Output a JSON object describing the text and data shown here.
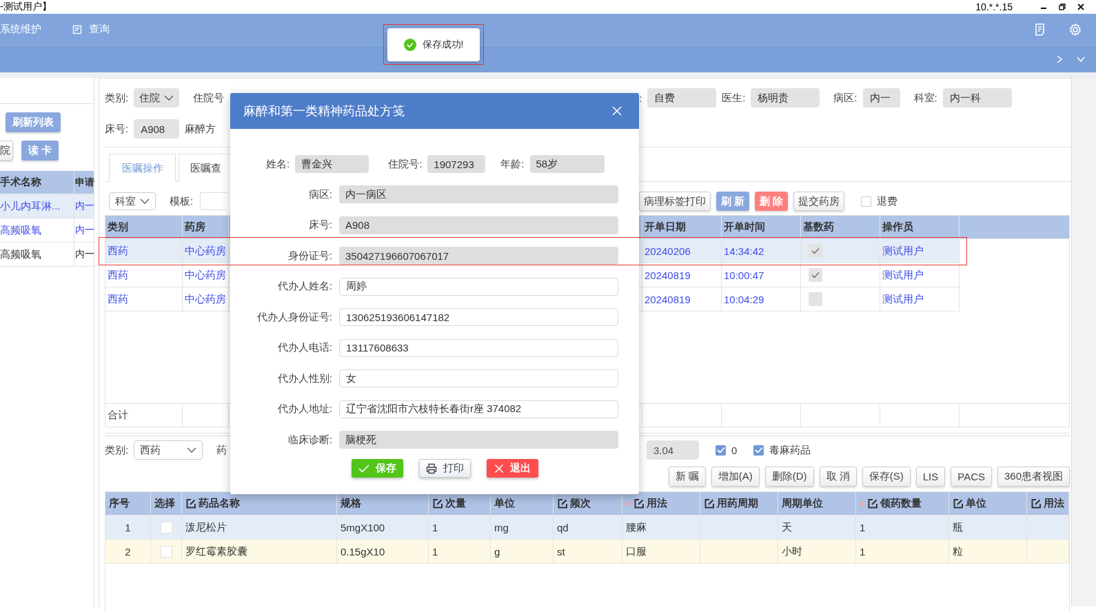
{
  "title_bar": {
    "title": "-测试用户】",
    "address": "10.*.*.15"
  },
  "nav": {
    "items": [
      {
        "label": "系统维护",
        "kind": "text"
      },
      {
        "label": "查询",
        "kind": "icon"
      }
    ]
  },
  "toast": {
    "message": "保存成功!",
    "highlighted": true
  },
  "left_panel": {
    "buttons": [
      {
        "label": "刷新列表",
        "kind": "primary"
      },
      {
        "label": "院",
        "kind": "plain"
      },
      {
        "label": "读 卡",
        "kind": "primary"
      }
    ],
    "columns": [
      "手术名称",
      "申请"
    ],
    "rows": [
      {
        "cells": [
          "小儿内耳淋...",
          "内一"
        ],
        "selected": true,
        "color": "#3d4bea"
      },
      {
        "cells": [
          "高频吸氧",
          "内一"
        ],
        "selected": false,
        "color": "#3d4bea"
      },
      {
        "cells": [
          "高频吸氧",
          "内一"
        ],
        "selected": false,
        "color": "#333333"
      }
    ]
  },
  "filters": {
    "row1_left": [
      {
        "label": "类别:",
        "value": "住院",
        "kind": "select"
      },
      {
        "label": "住院号",
        "kind": "label"
      }
    ],
    "row1_right": [
      {
        "label": ":",
        "value": "自费",
        "kind": "field"
      },
      {
        "label": "医生:",
        "value": "杨明贵",
        "kind": "field"
      },
      {
        "label": "病区:",
        "value": "内一",
        "kind": "field"
      },
      {
        "label": "科室:",
        "value": "内一科",
        "kind": "field"
      }
    ],
    "row2_left": [
      {
        "label": "床号:",
        "value": "A908",
        "kind": "field"
      },
      {
        "label": "麻醉方",
        "kind": "label"
      }
    ]
  },
  "tabs": [
    {
      "label": "医嘱操作",
      "selected": true
    },
    {
      "label": "医嘱查",
      "selected": false
    }
  ],
  "toolbar": {
    "left": [
      {
        "value": "科室",
        "kind": "select"
      },
      {
        "label": "模板:",
        "kind": "field"
      }
    ],
    "buttons": [
      {
        "label": "病理标签打印",
        "kind": "plain"
      },
      {
        "label": "刷 新",
        "kind": "primary"
      },
      {
        "label": "删 除",
        "kind": "danger"
      },
      {
        "label": "提交药房",
        "kind": "plain"
      }
    ],
    "refund": {
      "label": "退费",
      "checked": false
    }
  },
  "orders_table": {
    "columns": [
      "类别",
      "药房",
      "开单日期",
      "开单时间",
      "基数药",
      "操作员"
    ],
    "rows": [
      {
        "category": "西药",
        "pharmacy": "中心药房",
        "date": "20240206",
        "time": "14:34:42",
        "base_drug": true,
        "operator": "测试用户",
        "selected": true,
        "highlighted": true
      },
      {
        "category": "西药",
        "pharmacy": "中心药房",
        "date": "20240819",
        "time": "10:00:47",
        "base_drug": true,
        "operator": "测试用户",
        "selected": false,
        "highlighted": false
      },
      {
        "category": "西药",
        "pharmacy": "中心药房",
        "date": "20240819",
        "time": "10:04:29",
        "base_drug": false,
        "operator": "测试用户",
        "selected": false,
        "highlighted": false
      }
    ],
    "total_label": "合计"
  },
  "lower_filter": {
    "category_label": "类别:",
    "category_value": "西药",
    "cut_label": "药",
    "amount": "3.04",
    "checks": [
      {
        "label": "0",
        "checked": true
      },
      {
        "label": "毒麻药品",
        "checked": true
      }
    ]
  },
  "action_buttons": [
    "新 嘱",
    "增加(A)",
    "删除(D)",
    "取 消",
    "保存(S)",
    "LIS",
    "PACS",
    "360患者视图"
  ],
  "drug_table": {
    "columns": [
      {
        "label": "序号",
        "editable": false,
        "required": false
      },
      {
        "label": "选择",
        "editable": false,
        "required": false
      },
      {
        "label": "药品名称",
        "editable": true,
        "required": false
      },
      {
        "label": "规格",
        "editable": false,
        "required": false
      },
      {
        "label": "次量",
        "editable": true,
        "required": false
      },
      {
        "label": "单位",
        "editable": false,
        "required": false
      },
      {
        "label": "频次",
        "editable": true,
        "required": false
      },
      {
        "label": "用法",
        "editable": true,
        "required": true
      },
      {
        "label": "用药周期",
        "editable": true,
        "required": false
      },
      {
        "label": "周期单位",
        "editable": false,
        "required": false
      },
      {
        "label": "领药数量",
        "editable": true,
        "required": true
      },
      {
        "label": "单位",
        "editable": true,
        "required": false
      },
      {
        "label": "用法",
        "editable": true,
        "required": false
      }
    ],
    "rows": [
      {
        "checked": false,
        "cells": [
          "1",
          "",
          "泼尼松片",
          "5mgX100",
          "1",
          "mg",
          "qd",
          "腰麻",
          "",
          "天",
          "1",
          "瓶",
          ""
        ],
        "color": "#e4ecf7"
      },
      {
        "checked": false,
        "cells": [
          "2",
          "",
          "罗红霉素胶囊",
          "0.15gX10",
          "1",
          "g",
          "st",
          "口服",
          "",
          "小时",
          "1",
          "粒",
          ""
        ],
        "color": "#fdf9e4"
      }
    ]
  },
  "modal": {
    "title": "麻醉和第一类精神药品处方笺",
    "top_fields": [
      {
        "label": "姓名:",
        "value": "曹金兴"
      },
      {
        "label": "住院号:",
        "value": "1907293"
      },
      {
        "label": "年龄:",
        "value": "58岁"
      }
    ],
    "fields": [
      {
        "label": "病区:",
        "value": "内一病区",
        "kind": "readonly"
      },
      {
        "label": "床号:",
        "value": "A908",
        "kind": "readonly"
      },
      {
        "label": "身份证号:",
        "value": "350427196607067017",
        "kind": "readonly"
      },
      {
        "label": "代办人姓名:",
        "value": "周婷",
        "kind": "input"
      },
      {
        "label": "代办人身份证号:",
        "value": "130625193606147182",
        "kind": "input"
      },
      {
        "label": "代办人电话:",
        "value": "13117608633",
        "kind": "input"
      },
      {
        "label": "代办人性别:",
        "value": "女",
        "kind": "input"
      },
      {
        "label": "代办人地址:",
        "value": "辽宁省沈阳市六枝特长春街r座 374082",
        "kind": "input"
      },
      {
        "label": "临床诊断:",
        "value": "脑梗死",
        "kind": "readonly"
      }
    ],
    "buttons": [
      {
        "label": "保存",
        "kind": "save"
      },
      {
        "label": "打印",
        "kind": "print"
      },
      {
        "label": "退出",
        "kind": "exit"
      }
    ]
  }
}
